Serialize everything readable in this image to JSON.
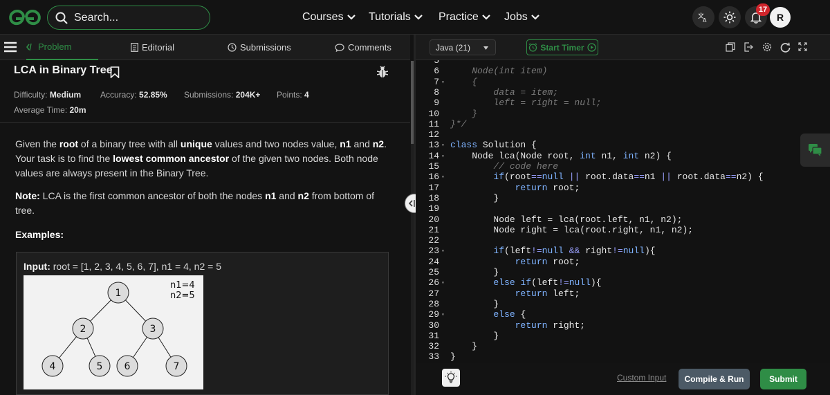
{
  "header": {
    "search_placeholder": "Search...",
    "nav": [
      "Courses",
      "Tutorials",
      "Practice",
      "Jobs"
    ],
    "notifications_count": "17",
    "avatar_initial": "R",
    "brand_color": "#2f8d46"
  },
  "problem_tabs": {
    "problem": "Problem",
    "editorial": "Editorial",
    "submissions": "Submissions",
    "comments": "Comments"
  },
  "problem": {
    "title": "LCA in Binary Tree",
    "difficulty_label": "Difficulty:",
    "difficulty": "Medium",
    "accuracy_label": "Accuracy:",
    "accuracy": "52.85%",
    "submissions_label": "Submissions:",
    "submissions": "204K+",
    "points_label": "Points:",
    "points": "4",
    "avg_time_label": "Average Time:",
    "avg_time": "20m",
    "desc": {
      "p1": "Given the ",
      "b1": "root",
      "p2": " of a binary tree with all ",
      "b2": "unique",
      "p3": " values and two nodes value, ",
      "b3": "n1",
      "p4": " and ",
      "b4": "n2",
      "p5": ". Your task is to find the ",
      "b5": "lowest common ancestor",
      "p6": " of the given two nodes. Both node values are always present in the Binary Tree."
    },
    "note": {
      "label": "Note:",
      "p1": " LCA is the first common ancestor of both the nodes ",
      "b1": "n1",
      "p2": " and ",
      "b2": "n2",
      "p3": " from bottom of tree."
    },
    "examples_heading": "Examples:",
    "example_input_label": "Input:",
    "example_input": " root = [1, 2, 3, 4, 5, 6, 7], n1 = 4, n2 = 5",
    "tree_nodes": [
      "1",
      "2",
      "3",
      "4",
      "5",
      "6",
      "7"
    ],
    "tree_note_1": "n1=4",
    "tree_note_2": "n2=5"
  },
  "editor": {
    "language": "Java (21)",
    "timer_label": "Start Timer",
    "custom_input": "Custom Input",
    "compile_run": "Compile & Run",
    "submit": "Submit",
    "code_lines": [
      {
        "n": "5",
        "t": ""
      },
      {
        "n": "6",
        "t": "    Node(int item)"
      },
      {
        "n": "7",
        "t": "    {"
      },
      {
        "n": "8",
        "t": "        data = item;"
      },
      {
        "n": "9",
        "t": "        left = right = null;"
      },
      {
        "n": "10",
        "t": "    }"
      },
      {
        "n": "11",
        "t": "}*/"
      },
      {
        "n": "12",
        "t": ""
      },
      {
        "n": "13",
        "t": "class Solution {"
      },
      {
        "n": "14",
        "t": "    Node lca(Node root, int n1, int n2) {"
      },
      {
        "n": "15",
        "t": "        // code here"
      },
      {
        "n": "16",
        "t": "        if(root==null || root.data==n1 || root.data==n2) {"
      },
      {
        "n": "17",
        "t": "            return root;"
      },
      {
        "n": "18",
        "t": "        }"
      },
      {
        "n": "19",
        "t": ""
      },
      {
        "n": "20",
        "t": "        Node left = lca(root.left, n1, n2);"
      },
      {
        "n": "21",
        "t": "        Node right = lca(root.right, n1, n2);"
      },
      {
        "n": "22",
        "t": ""
      },
      {
        "n": "23",
        "t": "        if(left!=null && right!=null){"
      },
      {
        "n": "24",
        "t": "            return root;"
      },
      {
        "n": "25",
        "t": "        }"
      },
      {
        "n": "26",
        "t": "        else if(left!=null){"
      },
      {
        "n": "27",
        "t": "            return left;"
      },
      {
        "n": "28",
        "t": "        }"
      },
      {
        "n": "29",
        "t": "        else {"
      },
      {
        "n": "30",
        "t": "            return right;"
      },
      {
        "n": "31",
        "t": "        }"
      },
      {
        "n": "32",
        "t": "    }"
      },
      {
        "n": "33",
        "t": "}"
      }
    ]
  }
}
